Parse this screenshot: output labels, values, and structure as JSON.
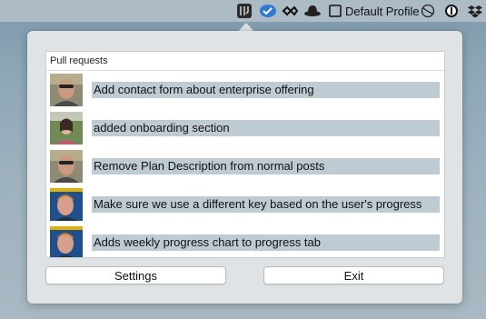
{
  "menubar": {
    "icons": [
      "pull-request-app-icon",
      "checkmark-cloud-icon",
      "infinity-icon",
      "hat-icon",
      "window-icon",
      "globe-icon",
      "info-icon",
      "dropbox-icon"
    ],
    "profile_label": "Default Profile"
  },
  "panel": {
    "header": "Pull requests",
    "items": [
      {
        "title": "Add contact form about enterprise offering",
        "avatar": "avatar-1"
      },
      {
        "title": "added onboarding section",
        "avatar": "avatar-2"
      },
      {
        "title": "Remove Plan Description from normal posts",
        "avatar": "avatar-1"
      },
      {
        "title": "Make sure we use a different key based on the user's progress",
        "avatar": "avatar-3"
      },
      {
        "title": "Adds weekly progress chart to progress tab",
        "avatar": "avatar-3"
      }
    ]
  },
  "buttons": {
    "settings_label": "Settings",
    "exit_label": "Exit"
  },
  "colors": {
    "title_highlight": "#bfcbd3",
    "popover_bg": "#dfe3e6"
  }
}
